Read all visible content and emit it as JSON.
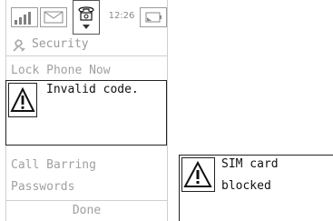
{
  "status_bar": {
    "time": "12:26",
    "icons": [
      "signal-icon",
      "mail-icon",
      "phone-icon",
      "battery-icon"
    ]
  },
  "screen": {
    "title_icon": "wrench-icon",
    "title": "Security",
    "menu_items": [
      {
        "label": "Lock Phone Now"
      },
      {
        "label": "Call Barring"
      },
      {
        "label": "Passwords"
      }
    ],
    "done_label": "Done"
  },
  "dialog": {
    "icon": "warning-icon",
    "message": "Invalid code."
  },
  "sim_dialog": {
    "icon": "warning-icon",
    "line1": "SIM card",
    "line2": "blocked"
  }
}
